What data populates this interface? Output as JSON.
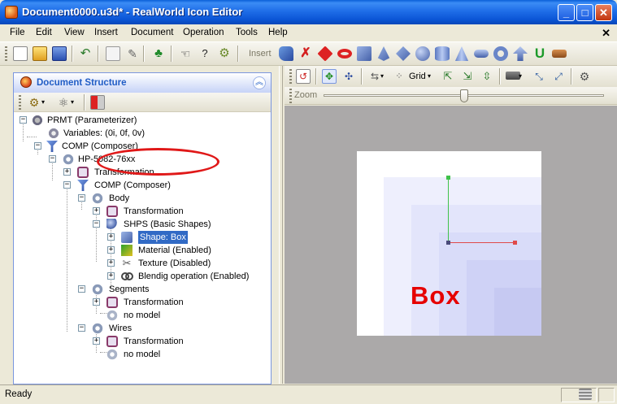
{
  "window": {
    "title": "Document0000.u3d* - RealWorld Icon Editor"
  },
  "menu": [
    "File",
    "Edit",
    "View",
    "Insert",
    "Document",
    "Operation",
    "Tools",
    "Help"
  ],
  "toolbar": {
    "insert_label": "Insert"
  },
  "document_structure": {
    "title": "Document Structure",
    "tree": [
      {
        "label": "PRMT (Parameterizer)",
        "icon": "gears-icon"
      },
      {
        "label": "Variables: (0i, 0f, 0v)",
        "icon": "variable-icon"
      },
      {
        "label": "COMP (Composer)",
        "icon": "composer-icon"
      },
      {
        "label": "HP-5082-76xx",
        "icon": "nut-icon"
      },
      {
        "label": "Transformation",
        "icon": "transform-icon"
      },
      {
        "label": "COMP (Composer)",
        "icon": "composer-icon"
      },
      {
        "label": "Body",
        "icon": "nut-icon"
      },
      {
        "label": "Transformation",
        "icon": "transform-icon"
      },
      {
        "label": "SHPS (Basic Shapes)",
        "icon": "shapes-icon"
      },
      {
        "label": "Shape: Box",
        "icon": "box-icon"
      },
      {
        "label": "Material (Enabled)",
        "icon": "material-icon"
      },
      {
        "label": "Texture (Disabled)",
        "icon": "texture-icon"
      },
      {
        "label": "Blendig operation (Enabled)",
        "icon": "blend-icon"
      },
      {
        "label": "Segments",
        "icon": "nut-icon"
      },
      {
        "label": "Transformation",
        "icon": "transform-icon"
      },
      {
        "label": "no model",
        "icon": "nut-icon"
      },
      {
        "label": "Wires",
        "icon": "nut-icon"
      },
      {
        "label": "Transformation",
        "icon": "transform-icon"
      },
      {
        "label": "no model",
        "icon": "nut-icon"
      }
    ]
  },
  "view_toolbar": {
    "grid_label": "Grid",
    "zoom_label": "Zoom",
    "zoom_level": 0.5
  },
  "preview": {
    "shape_text": "Box"
  },
  "status": {
    "text": "Ready"
  },
  "colors": {
    "accent": "#316ac5",
    "highlight": "#e01818",
    "shape_text": "#e60000"
  }
}
